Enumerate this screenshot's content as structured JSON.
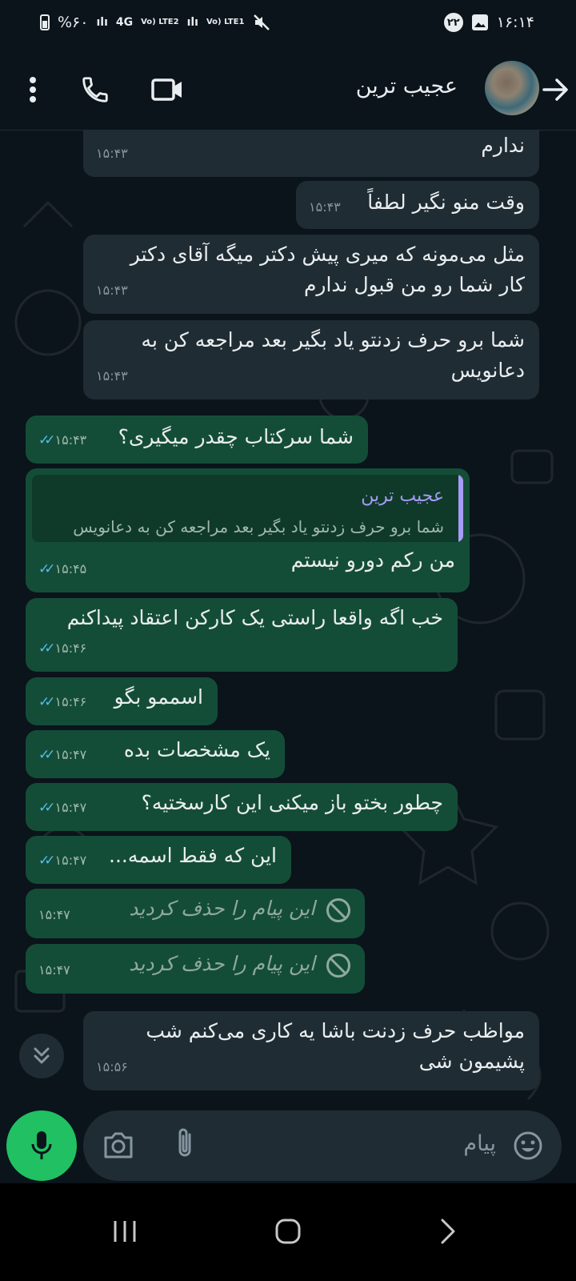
{
  "status_bar": {
    "battery": "%۶۰",
    "network_1": "4G",
    "network_lte1": "Vo) LTE2",
    "network_lte2": "Vo) LTE1",
    "notification_count": "۲۲",
    "time": "۱۶:۱۴"
  },
  "header": {
    "contact_name": "عجیب ترین"
  },
  "messages": [
    {
      "text": "ندارم",
      "time": "۱۵:۴۳"
    },
    {
      "text": "وقت منو نگیر لطفاً",
      "time": "۱۵:۴۳"
    },
    {
      "line1": "مثل می‌مونه که میری پیش دکتر میگه آقای دکتر",
      "line2": "کار شما رو من قبول ندارم",
      "time": "۱۵:۴۳"
    },
    {
      "line1": "شما برو حرف زدنتو یاد بگیر بعد مراجعه کن به",
      "line2": "دعانویس",
      "time": "۱۵:۴۳"
    },
    {
      "text": "شما سرکتاب چقدر میگیری؟",
      "time": "۱۵:۴۳"
    },
    {
      "quote_name": "عجیب ترین",
      "quote_text": "شما برو حرف زدنتو یاد بگیر بعد مراجعه کن به دعانویس",
      "text": "من رکم دورو نیستم",
      "time": "۱۵:۴۵"
    },
    {
      "text": "خب اگه واقعا راستی یک کارکن اعتقاد پیداکنم",
      "time": "۱۵:۴۶"
    },
    {
      "text": "اسممو بگو",
      "time": "۱۵:۴۶"
    },
    {
      "text": "یک مشخصات بده",
      "time": "۱۵:۴۷"
    },
    {
      "text": "چطور بختو باز میکنی این کارسختیه؟",
      "time": "۱۵:۴۷"
    },
    {
      "text": "این که فقط اسمه...",
      "time": "۱۵:۴۷"
    },
    {
      "text": "این پیام را حذف کردید",
      "time": "۱۵:۴۷"
    },
    {
      "text": "این پیام را حذف کردید",
      "time": "۱۵:۴۷"
    },
    {
      "line1": "مواظب حرف زدنت باشا یه کاری می‌کنم شب",
      "line2": "پشیمون شی",
      "time": "۱۵:۵۶"
    }
  ],
  "input": {
    "placeholder": "پیام"
  },
  "colors": {
    "background": "#0b141a",
    "incoming_bubble": "#1f2c33",
    "outgoing_bubble": "#144d37",
    "read_ticks": "#53bdeb",
    "mic_button": "#21c063",
    "quote_accent": "#a69cf5"
  },
  "icons": [
    "more-vert-icon",
    "phone-icon",
    "video-call-icon",
    "back-arrow-icon",
    "camera-icon",
    "attach-icon",
    "emoji-icon",
    "mic-icon",
    "double-chevron-down-icon",
    "blocked-icon"
  ]
}
